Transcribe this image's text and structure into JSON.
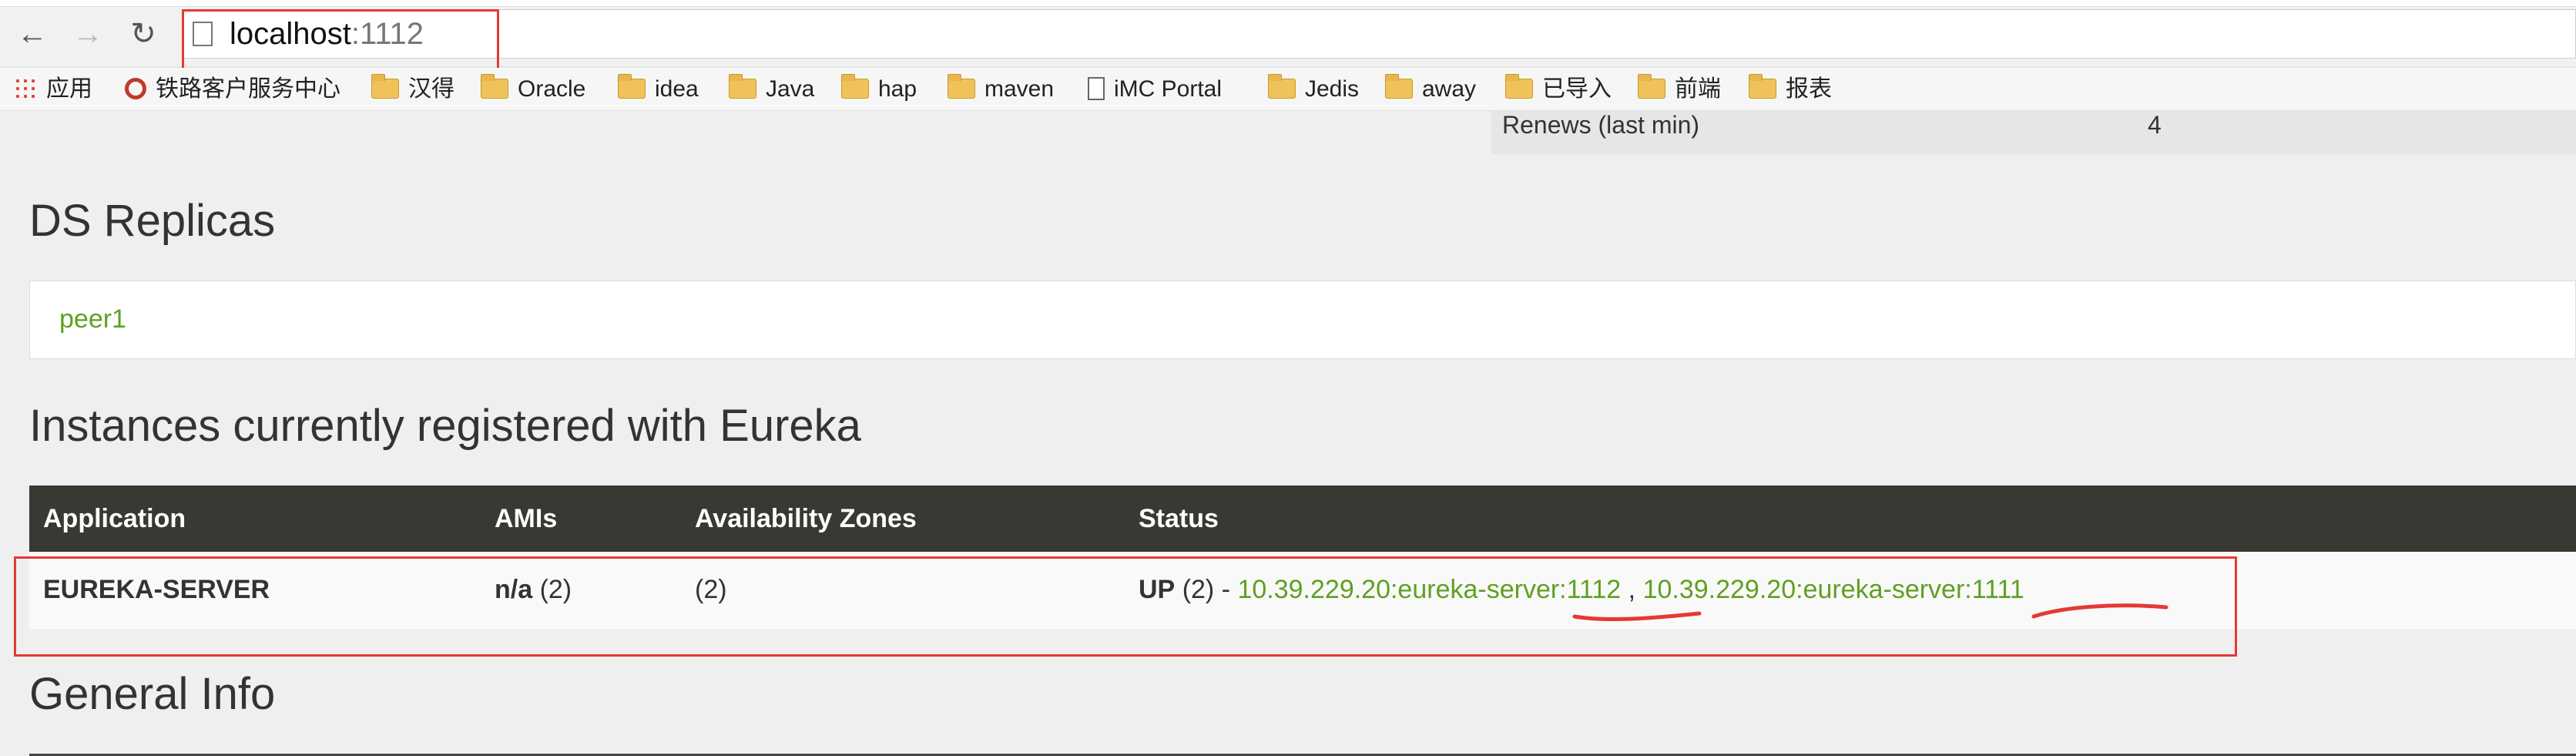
{
  "browser": {
    "back_glyph": "←",
    "forward_glyph": "→",
    "reload_glyph": "↻",
    "url_host": "localhost",
    "url_port": ":1112"
  },
  "bookmarks": [
    {
      "label": "应用",
      "icon": "apps-grid-icon"
    },
    {
      "label": "铁路客户服务中心",
      "icon": "site-favicon-icon"
    },
    {
      "label": "汉得",
      "icon": "folder-icon"
    },
    {
      "label": "Oracle",
      "icon": "folder-icon"
    },
    {
      "label": "idea",
      "icon": "folder-icon"
    },
    {
      "label": "Java",
      "icon": "folder-icon"
    },
    {
      "label": "hap",
      "icon": "folder-icon"
    },
    {
      "label": "maven",
      "icon": "folder-icon"
    },
    {
      "label": "iMC Portal",
      "icon": "page-icon"
    },
    {
      "label": "Jedis",
      "icon": "folder-icon"
    },
    {
      "label": "away",
      "icon": "folder-icon"
    },
    {
      "label": "已导入",
      "icon": "folder-icon"
    },
    {
      "label": "前端",
      "icon": "folder-icon"
    },
    {
      "label": "报表",
      "icon": "folder-icon"
    }
  ],
  "stats": {
    "renews_label": "Renews (last min)",
    "renews_value": "4"
  },
  "replicas": {
    "heading": "DS Replicas",
    "items": [
      "peer1"
    ]
  },
  "instances": {
    "heading": "Instances currently registered with Eureka",
    "columns": [
      "Application",
      "AMIs",
      "Availability Zones",
      "Status"
    ],
    "rows": [
      {
        "application": "EUREKA-SERVER",
        "amis_value": "n/a",
        "amis_count": "(2)",
        "zones": "(2)",
        "status_state": "UP",
        "status_count": "(2) -",
        "instance_links": [
          "10.39.229.20:eureka-server:1112",
          "10.39.229.20:eureka-server:1111"
        ],
        "link_separator": ","
      }
    ]
  },
  "general_info": {
    "heading": "General Info"
  },
  "colors": {
    "link_green": "#5fa022",
    "table_header": "#3a3833",
    "annotation_red": "#e53935"
  }
}
